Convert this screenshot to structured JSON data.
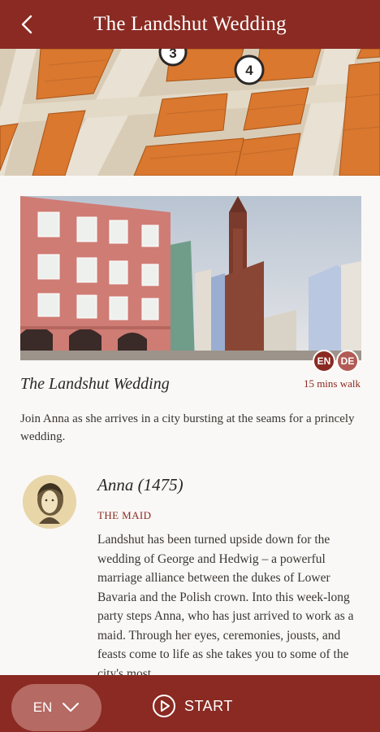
{
  "header": {
    "title": "The Landshut Wedding",
    "back_icon": "chevron-left-icon"
  },
  "map": {
    "markers": [
      "3",
      "4"
    ]
  },
  "walk": {
    "title": "The Landshut Wedding",
    "duration": "15 mins walk",
    "description": "Join Anna as she arrives in a city bursting at the seams for a princely wedding.",
    "languages": [
      "EN",
      "DE"
    ]
  },
  "character": {
    "name": "Anna (1475)",
    "role": "THE MAID",
    "bio": "Landshut has been turned upside down for the wedding of George and Hedwig – a powerful marriage alliance between the dukes of Lower Bavaria and the Polish crown. Into this week-long party steps Anna, who has just arrived to work as a maid. Through her eyes, ceremonies, jousts, and feasts come to life as she takes you to some of the city's most"
  },
  "bottom": {
    "language": "EN",
    "start_label": "START"
  },
  "colors": {
    "brand": "#8a2a22",
    "pill": "#b56a63",
    "badge_de": "#b25b54"
  }
}
